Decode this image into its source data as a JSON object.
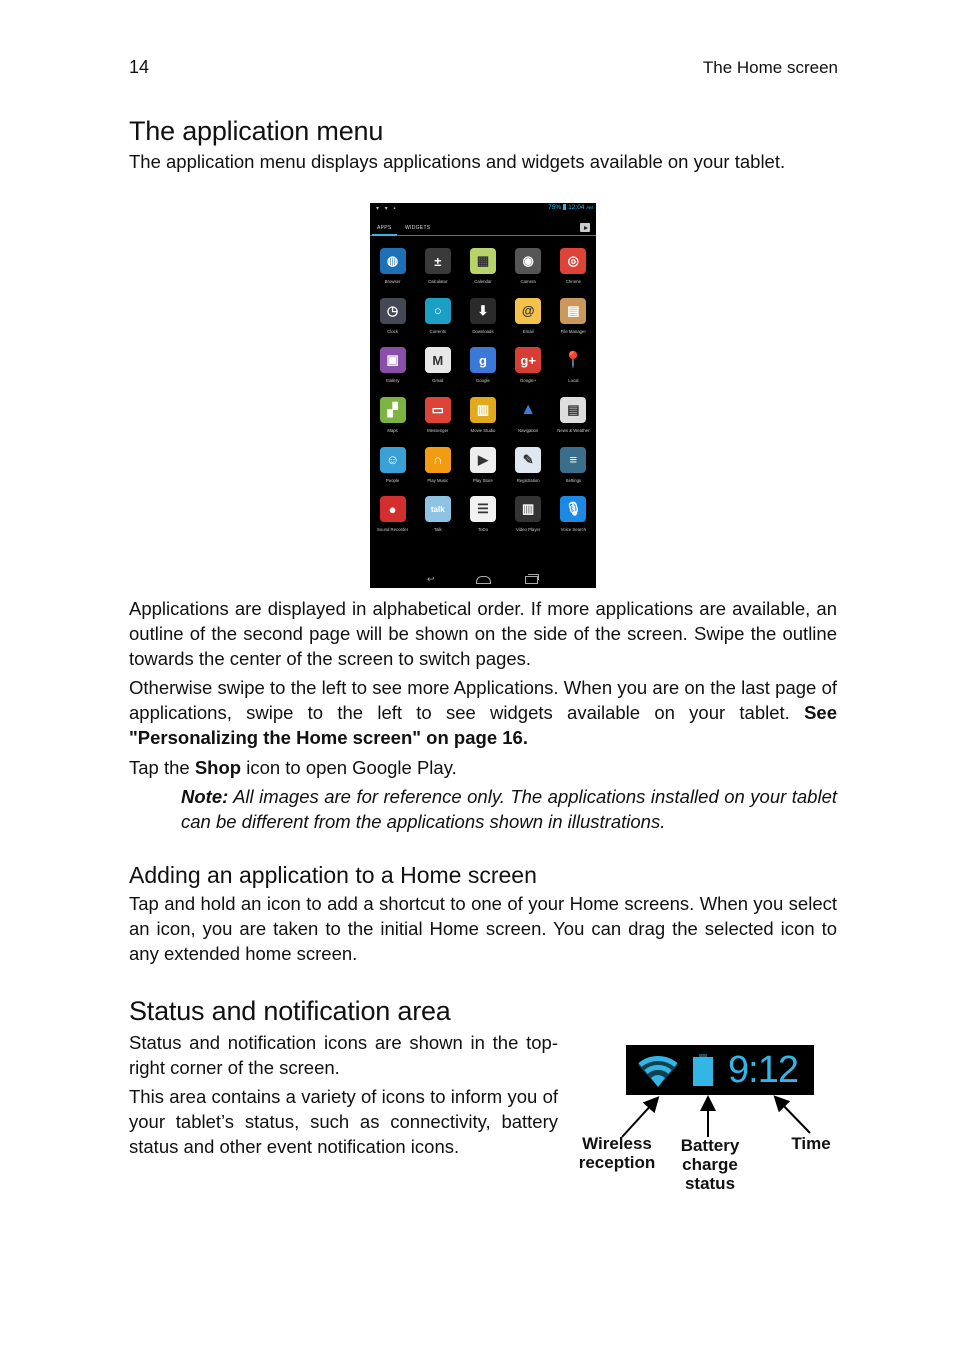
{
  "header": {
    "page_number": "14",
    "running_head": "The Home screen"
  },
  "section_app_menu": {
    "title": "The application menu",
    "intro": "The application menu displays applications and widgets available on your tablet.",
    "para1": "Applications are displayed in alphabetical order. If more applications are available, an outline of the second page will be shown on the side of the screen. Swipe the outline towards the center of the screen to switch pages.",
    "para2": "Otherwise swipe to the left to see more Applications. When you are on the last page of applications, swipe to the left to see widgets available on your tablet.",
    "para2_link": "See \"Personalizing the Home screen\" on page 16.",
    "tap_prefix": "Tap the ",
    "tap_bold": "Shop",
    "tap_suffix": " icon to open Google Play.",
    "note_label": "Note:",
    "note_text": " All images are for reference only. The applications installed on your tablet can be different from the applications shown in illustrations."
  },
  "tablet_screenshot": {
    "status_left_icons": "▾ ▾ ▪",
    "battery_percent": "75%",
    "time": "12:04",
    "ampm": "AM",
    "tabs": [
      "APPS",
      "WIDGETS"
    ],
    "active_tab": "APPS",
    "shop_icon": "shop-icon",
    "apps": [
      {
        "label": "Browser",
        "icon": "globe-icon",
        "color": "#1e6fb5",
        "glyph": "◍"
      },
      {
        "label": "Calculator",
        "icon": "calculator-icon",
        "color": "#3a3a3a",
        "glyph": "±"
      },
      {
        "label": "Calendar",
        "icon": "calendar-icon",
        "color": "#b9d36b",
        "glyph": "▦"
      },
      {
        "label": "Camera",
        "icon": "camera-icon",
        "color": "#555555",
        "glyph": "◉"
      },
      {
        "label": "Chrome",
        "icon": "chrome-icon",
        "color": "#db4437",
        "glyph": "◎"
      },
      {
        "label": "Clock",
        "icon": "clock-icon",
        "color": "#444a55",
        "glyph": "◷"
      },
      {
        "label": "Currents",
        "icon": "currents-icon",
        "color": "#1b9fc4",
        "glyph": "○"
      },
      {
        "label": "Downloads",
        "icon": "download-icon",
        "color": "#2b2b2b",
        "glyph": "⬇"
      },
      {
        "label": "Email",
        "icon": "email-icon",
        "color": "#f2c24a",
        "glyph": "@"
      },
      {
        "label": "File Manager",
        "icon": "file-manager-icon",
        "color": "#c9985a",
        "glyph": "▤"
      },
      {
        "label": "Gallery",
        "icon": "gallery-icon",
        "color": "#8a4fa8",
        "glyph": "▣"
      },
      {
        "label": "Gmail",
        "icon": "gmail-icon",
        "color": "#e8e8e8",
        "glyph": "M"
      },
      {
        "label": "Google",
        "icon": "google-icon",
        "color": "#3b78d8",
        "glyph": "g"
      },
      {
        "label": "Google+",
        "icon": "google-plus-icon",
        "color": "#d73d32",
        "glyph": "g+"
      },
      {
        "label": "Local",
        "icon": "map-pin-icon",
        "color": "#000000",
        "glyph": "📍"
      },
      {
        "label": "Maps",
        "icon": "maps-icon",
        "color": "#7cb342",
        "glyph": "▞"
      },
      {
        "label": "Messenger",
        "icon": "messenger-icon",
        "color": "#db4437",
        "glyph": "▭"
      },
      {
        "label": "Movie Studio",
        "icon": "clapperboard-icon",
        "color": "#e2a91c",
        "glyph": "▥"
      },
      {
        "label": "Navigation",
        "icon": "navigation-arrow-icon",
        "color": "#000000",
        "glyph": "▲"
      },
      {
        "label": "News & Weather",
        "icon": "news-icon",
        "color": "#dddddd",
        "glyph": "▤"
      },
      {
        "label": "People",
        "icon": "contacts-icon",
        "color": "#3aa0d8",
        "glyph": "☺"
      },
      {
        "label": "Play Music",
        "icon": "headphones-icon",
        "color": "#f39c12",
        "glyph": "∩"
      },
      {
        "label": "Play Store",
        "icon": "play-store-icon",
        "color": "#eeeeee",
        "glyph": "▶"
      },
      {
        "label": "Registration",
        "icon": "clipboard-icon",
        "color": "#dfe8f0",
        "glyph": "✎"
      },
      {
        "label": "Settings",
        "icon": "settings-sliders-icon",
        "color": "#3a6e8a",
        "glyph": "≡"
      },
      {
        "label": "Sound Recorder",
        "icon": "microphone-icon",
        "color": "#d32f2f",
        "glyph": "●"
      },
      {
        "label": "Talk",
        "icon": "talk-icon",
        "color": "#8fc3e3",
        "glyph": "talk"
      },
      {
        "label": "ToDo",
        "icon": "todo-list-icon",
        "color": "#f2f2f2",
        "glyph": "☰"
      },
      {
        "label": "Video Player",
        "icon": "clapperboard-icon",
        "color": "#333333",
        "glyph": "▥"
      },
      {
        "label": "Voice Search",
        "icon": "voice-search-icon",
        "color": "#1e88e5",
        "glyph": "🎙"
      }
    ],
    "nav_buttons": [
      "back-icon",
      "home-icon",
      "recent-apps-icon"
    ]
  },
  "section_adding": {
    "title": "Adding an application to a Home screen",
    "body": "Tap and hold an icon to add a shortcut to one of your Home screens. When you select an icon, you are taken to the initial Home screen. You can drag the selected icon to any extended home screen."
  },
  "section_status": {
    "title": "Status and notification area",
    "para1": "Status and notification icons are shown in the top-right corner of the screen.",
    "para2": "This area contains a variety of icons to inform you of your tablet’s status, such as connectivity, battery status and other event notification icons.",
    "illustration": {
      "time": "9:12",
      "accent_color": "#33b5e5",
      "callouts": {
        "wireless": [
          "Wireless",
          "reception"
        ],
        "battery": [
          "Battery",
          "charge",
          "status"
        ],
        "time": "Time"
      }
    }
  }
}
